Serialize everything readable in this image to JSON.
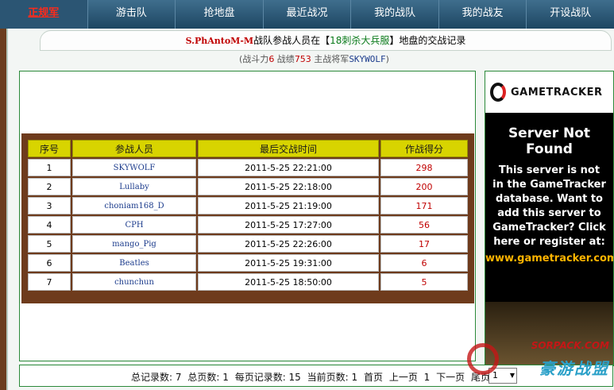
{
  "nav": {
    "items": [
      "正规军",
      "游击队",
      "抢地盘",
      "最近战况",
      "我的战队",
      "我的战友",
      "开设战队"
    ]
  },
  "header": {
    "team": "S.PhAntoM-M",
    "text_mid": "战队参战人员在【",
    "server": "18刺杀大兵服",
    "text_end": "】地盘的交战记录"
  },
  "subline": {
    "p1": "(战斗力",
    "power": "6",
    "p2": " 战绩",
    "record": "753",
    "p3": " 主战将军",
    "general": "SKYWOLF",
    "p4": ")"
  },
  "table": {
    "headers": [
      "序号",
      "参战人员",
      "最后交战时间",
      "作战得分"
    ],
    "rows": [
      [
        "1",
        "SKYWOLF",
        "2011-5-25 22:21:00",
        "298"
      ],
      [
        "2",
        "Lullaby",
        "2011-5-25 22:18:00",
        "200"
      ],
      [
        "3",
        "choniam168_D",
        "2011-5-25 21:19:00",
        "171"
      ],
      [
        "4",
        "CPH",
        "2011-5-25 17:27:00",
        "56"
      ],
      [
        "5",
        "mango_Pig",
        "2011-5-25 22:26:00",
        "17"
      ],
      [
        "6",
        "Beatles",
        "2011-5-25 19:31:00",
        "6"
      ],
      [
        "7",
        "chunchun",
        "2011-5-25 18:50:00",
        "5"
      ]
    ]
  },
  "pager": {
    "total": "总记录数: 7",
    "pages": "总页数: 1",
    "per_page": "每页记录数: 15",
    "current": "当前页数: 1",
    "first": "首页",
    "prev": "上一页",
    "page_no": "1",
    "next": "下一页",
    "last": "尾页",
    "select_value": "1"
  },
  "ad": {
    "brand": "GAMETRACKER",
    "title": "Server Not Found",
    "body": "This server is not in the GameTracker database. Want to add this server to GameTracker? Click here or register at:",
    "link": "www.gametracker.com"
  },
  "watermark": {
    "en": "SORPACK.COM",
    "cn": "豪游战盟"
  }
}
